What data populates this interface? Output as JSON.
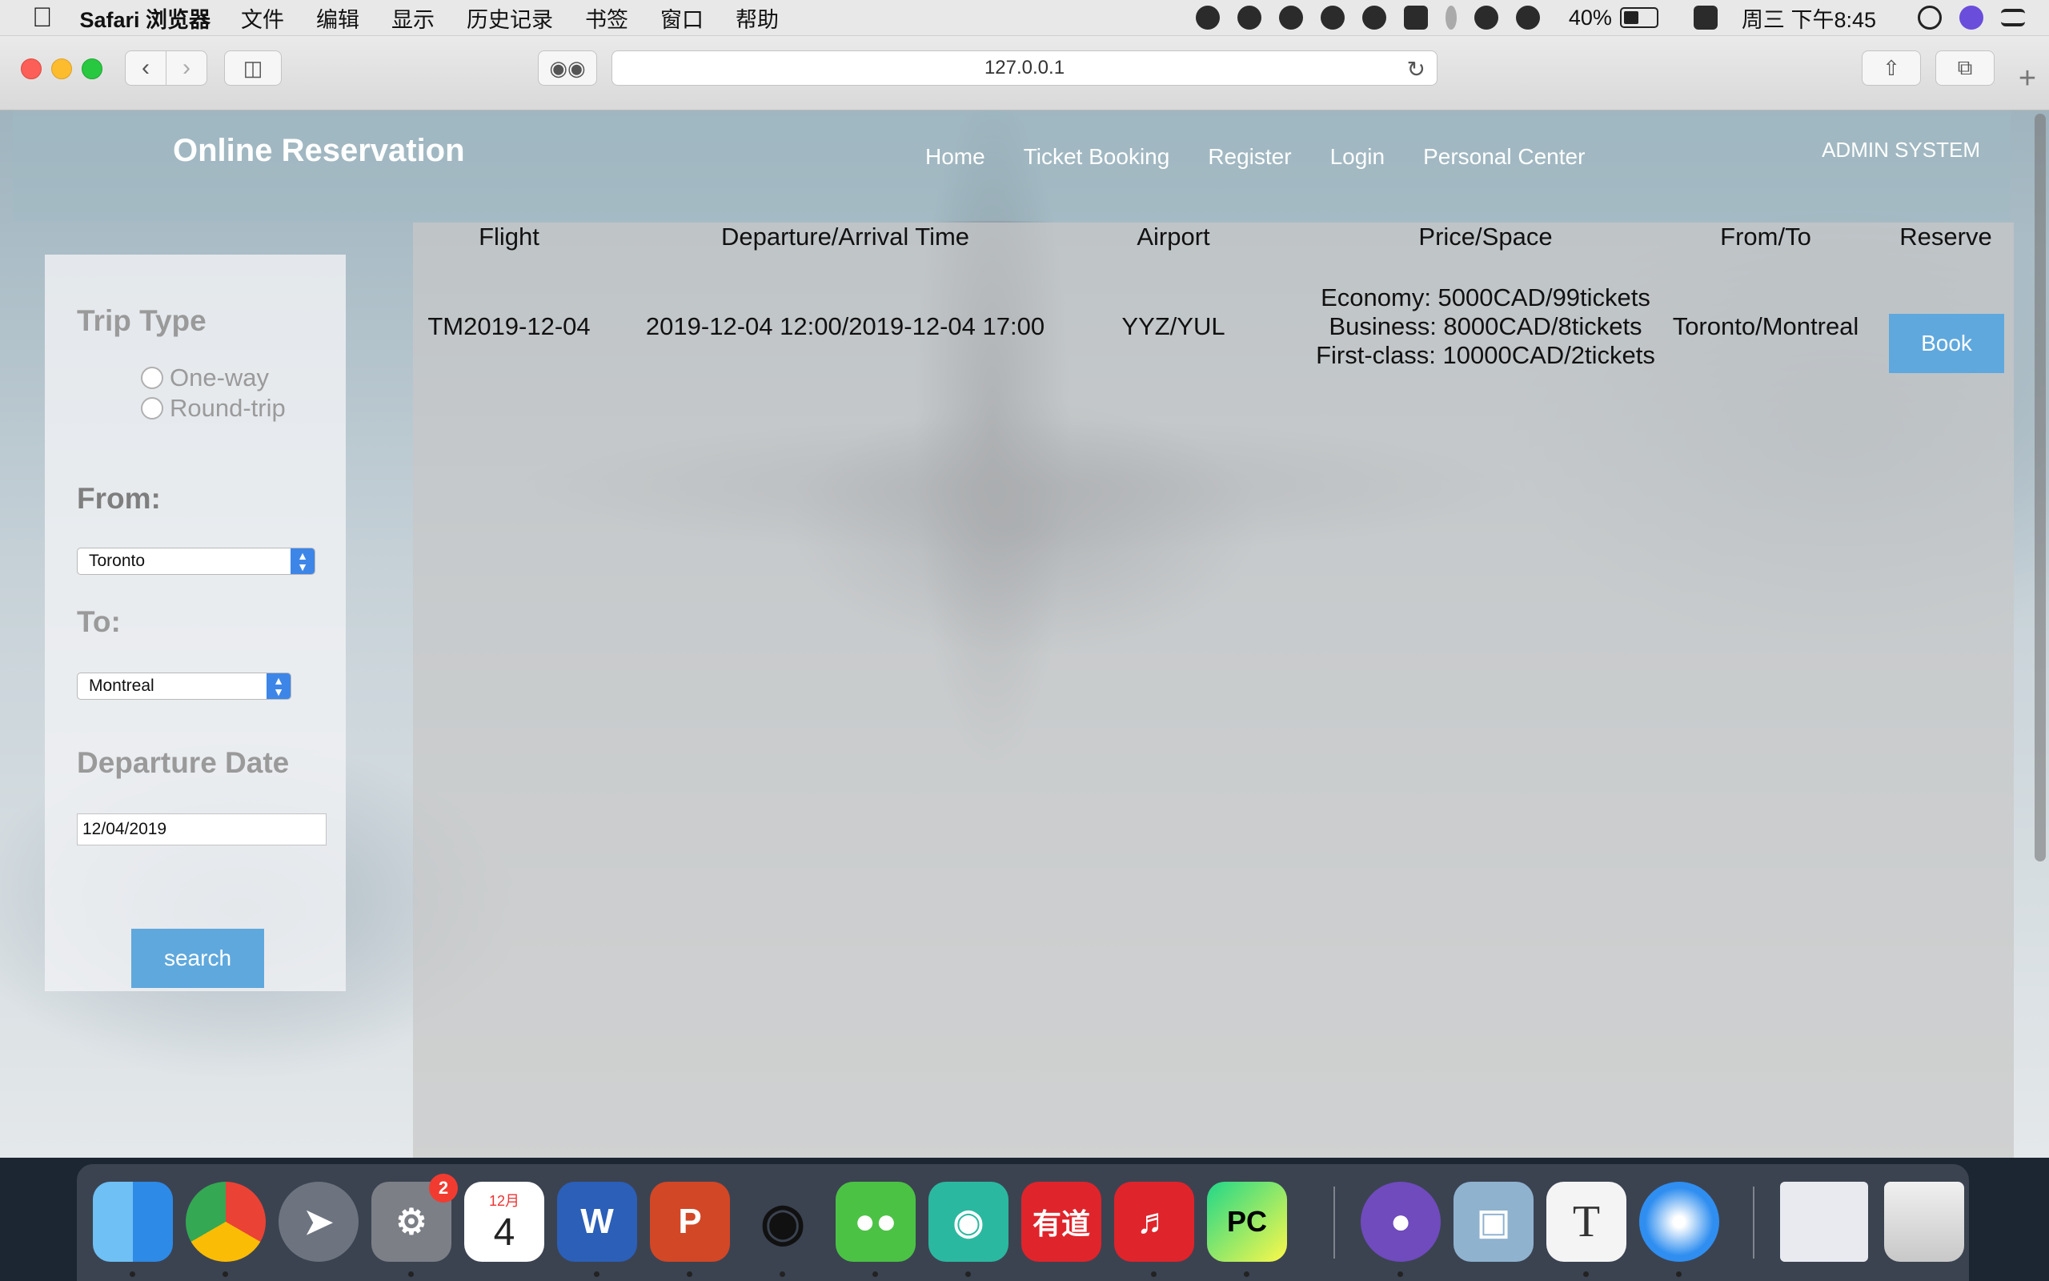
{
  "menubar": {
    "app_name": "Safari 浏览器",
    "menus": [
      "文件",
      "编辑",
      "显示",
      "历史记录",
      "书签",
      "窗口",
      "帮助"
    ],
    "battery_percent": "40%",
    "clock": "周三 下午8:45"
  },
  "browser": {
    "url": "127.0.0.1"
  },
  "site": {
    "title": "Online Reservation",
    "nav": [
      "Home",
      "Ticket Booking",
      "Register",
      "Login",
      "Personal Center"
    ],
    "admin_link": "ADMIN SYSTEM"
  },
  "search_form": {
    "trip_type_heading": "Trip Type",
    "trip_options": [
      "One-way",
      "Round-trip"
    ],
    "from_heading": "From:",
    "from_value": "Toronto",
    "to_heading": "To:",
    "to_value": "Montreal",
    "date_heading": "Departure Date",
    "date_value": "12/04/2019",
    "search_label": "search"
  },
  "results": {
    "columns": [
      "Flight",
      "Departure/Arrival Time",
      "Airport",
      "Price/Space",
      "From/To",
      "Reserve"
    ],
    "rows": [
      {
        "flight": "TM2019-12-04",
        "time": "2019-12-04 12:00/2019-12-04 17:00",
        "airport": "YYZ/YUL",
        "price_lines": [
          "Economy: 5000CAD/99tickets",
          "Business: 8000CAD/8tickets",
          "First-class: 10000CAD/2tickets"
        ],
        "from_to": "Toronto/Montreal",
        "reserve_label": "Book"
      }
    ]
  },
  "dock": {
    "calendar_month": "12月",
    "calendar_day": "4",
    "settings_badge": "2",
    "word_letter": "W",
    "ppt_letter": "P",
    "youdao_label": "有道",
    "pycharm_label": "PC",
    "typora_letter": "T"
  }
}
